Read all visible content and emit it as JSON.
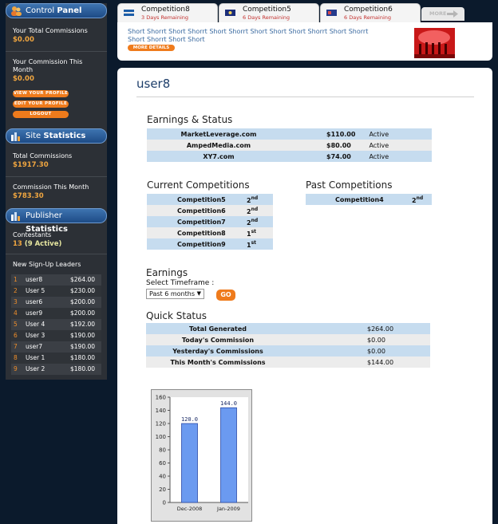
{
  "sidebar": {
    "control_panel": {
      "title_a": "Control",
      "title_b": "Panel",
      "total_commissions_label": "Your Total Commissions",
      "total_commissions_value": "$0.00",
      "month_commission_label": "Your Commission This Month",
      "month_commission_value": "$0.00",
      "buttons": [
        "VIEW YOUR PROFILE",
        "EDIT YOUR PROFILE",
        "LOGOUT"
      ]
    },
    "site_statistics": {
      "title_a": "Site",
      "title_b": "Statistics",
      "total_commissions_label": "Total Commissions",
      "total_commissions_value": "$1917.30",
      "month_commission_label": "Commission This Month",
      "month_commission_value": "$783.30"
    },
    "publisher_statistics": {
      "title_a": "Publisher",
      "title_b": "Statistics",
      "contestants_label": "Contestants",
      "contestants_count": "13",
      "contestants_active": "(9 Active)",
      "leaders_title": "New Sign-Up Leaders",
      "leaders": [
        {
          "rank": "1",
          "name": "user8",
          "amount": "$264.00"
        },
        {
          "rank": "2",
          "name": "User 5",
          "amount": "$230.00"
        },
        {
          "rank": "3",
          "name": "user6",
          "amount": "$200.00"
        },
        {
          "rank": "4",
          "name": "user9",
          "amount": "$200.00"
        },
        {
          "rank": "5",
          "name": "User 4",
          "amount": "$192.00"
        },
        {
          "rank": "6",
          "name": "User 3",
          "amount": "$190.00"
        },
        {
          "rank": "7",
          "name": "user7",
          "amount": "$190.00"
        },
        {
          "rank": "8",
          "name": "User 1",
          "amount": "$180.00"
        },
        {
          "rank": "9",
          "name": "User 2",
          "amount": "$180.00"
        }
      ]
    }
  },
  "tabs": [
    {
      "name": "Competition8",
      "remaining": "3 Days Remaining"
    },
    {
      "name": "Competition5",
      "remaining": "6 Days Remaining"
    },
    {
      "name": "Competition6",
      "remaining": "6 Days Remaining"
    }
  ],
  "more_tab": "MORE",
  "banner": {
    "text": "Short Shorrt Short Shorrt Short Shorrt Short Short Short Shorrt Short Shorrt Short Shorrt Short Short",
    "more_details": "MORE DETAILS"
  },
  "main": {
    "username": "user8",
    "earnings_status": {
      "title": "Earnings & Status",
      "rows": [
        {
          "site": "MarketLeverage.com",
          "amount": "$110.00",
          "status": "Active"
        },
        {
          "site": "AmpedMedia.com",
          "amount": "$80.00",
          "status": "Active"
        },
        {
          "site": "XY7.com",
          "amount": "$74.00",
          "status": "Active"
        }
      ]
    },
    "current_competitions": {
      "title": "Current Competitions",
      "rows": [
        {
          "name": "Competition5",
          "place": "2",
          "suffix": "nd"
        },
        {
          "name": "Competition6",
          "place": "2",
          "suffix": "nd"
        },
        {
          "name": "Competition7",
          "place": "2",
          "suffix": "nd"
        },
        {
          "name": "Competition8",
          "place": "1",
          "suffix": "st"
        },
        {
          "name": "Competition9",
          "place": "1",
          "suffix": "st"
        }
      ]
    },
    "past_competitions": {
      "title": "Past Competitions",
      "rows": [
        {
          "name": "Competition4",
          "place": "2",
          "suffix": "nd"
        }
      ]
    },
    "earnings": {
      "title": "Earnings",
      "timeframe_label": "Select Timeframe :",
      "timeframe_value": "Past 6 months",
      "go_label": "GO"
    },
    "quick_status": {
      "title": "Quick Status",
      "rows": [
        {
          "label": "Total Generated",
          "value": "$264.00"
        },
        {
          "label": "Today's Commission",
          "value": "$0.00"
        },
        {
          "label": "Yesterday's Commissions",
          "value": "$0.00"
        },
        {
          "label": "This Month's Commissions",
          "value": "$144.00"
        }
      ]
    }
  },
  "colors": {
    "accent_orange": "#ef7b1c",
    "value_orange": "#f0a640",
    "row_blue": "#c6dcef",
    "bar_blue": "#6b9af0"
  },
  "chart_data": {
    "type": "bar",
    "categories": [
      "Dec-2008",
      "Jan-2009"
    ],
    "values": [
      120.0,
      144.0
    ],
    "data_labels": [
      "120.0",
      "144.0"
    ],
    "yticks": [
      0,
      20,
      40,
      60,
      80,
      100,
      120,
      140,
      160
    ],
    "ylim": [
      0,
      160
    ],
    "grid": false
  }
}
